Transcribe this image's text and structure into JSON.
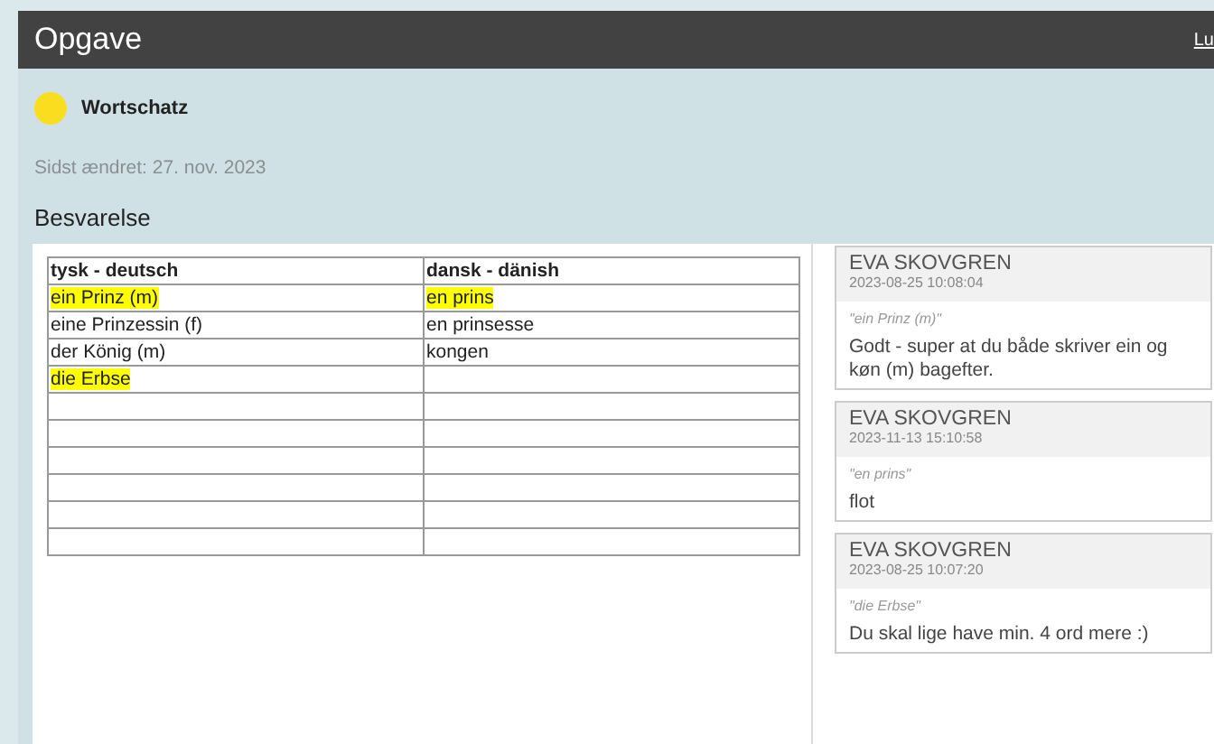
{
  "header": {
    "title": "Opgave",
    "link": "Lu"
  },
  "subject": {
    "name": "Wortschatz",
    "color": "#fbdd1f"
  },
  "modified": "Sidst ændret: 27. nov. 2023",
  "section_title": "Besvarelse",
  "table": {
    "columns": [
      "tysk - deutsch",
      "dansk - dänish"
    ],
    "rows": [
      [
        {
          "text": "ein Prinz (m)",
          "highlighted": true
        },
        {
          "text": "en prins",
          "highlighted": true
        }
      ],
      [
        {
          "text": "eine Prinzessin (f)",
          "highlighted": false
        },
        {
          "text": "en prinsesse",
          "highlighted": false
        }
      ],
      [
        {
          "text": "der König (m)",
          "highlighted": false
        },
        {
          "text": "kongen",
          "highlighted": false
        }
      ],
      [
        {
          "text": "die Erbse",
          "highlighted": true
        },
        {}
      ],
      [
        {},
        {}
      ],
      [
        {},
        {}
      ],
      [
        {},
        {}
      ],
      [
        {},
        {}
      ],
      [
        {},
        {}
      ],
      [
        {},
        {}
      ]
    ]
  },
  "comments": [
    {
      "author": "EVA SKOVGREN",
      "time": "2023-08-25 10:08:04",
      "quote": "\"ein Prinz (m)\"",
      "text": "Godt - super at du både skriver ein og køn (m) bagefter."
    },
    {
      "author": "EVA SKOVGREN",
      "time": "2023-11-13 15:10:58",
      "quote": "\"en prins\"",
      "text": "flot"
    },
    {
      "author": "EVA SKOVGREN",
      "time": "2023-08-25 10:07:20",
      "quote": "\"die Erbse\"",
      "text": "Du skal lige have min. 4 ord mere :)"
    }
  ]
}
